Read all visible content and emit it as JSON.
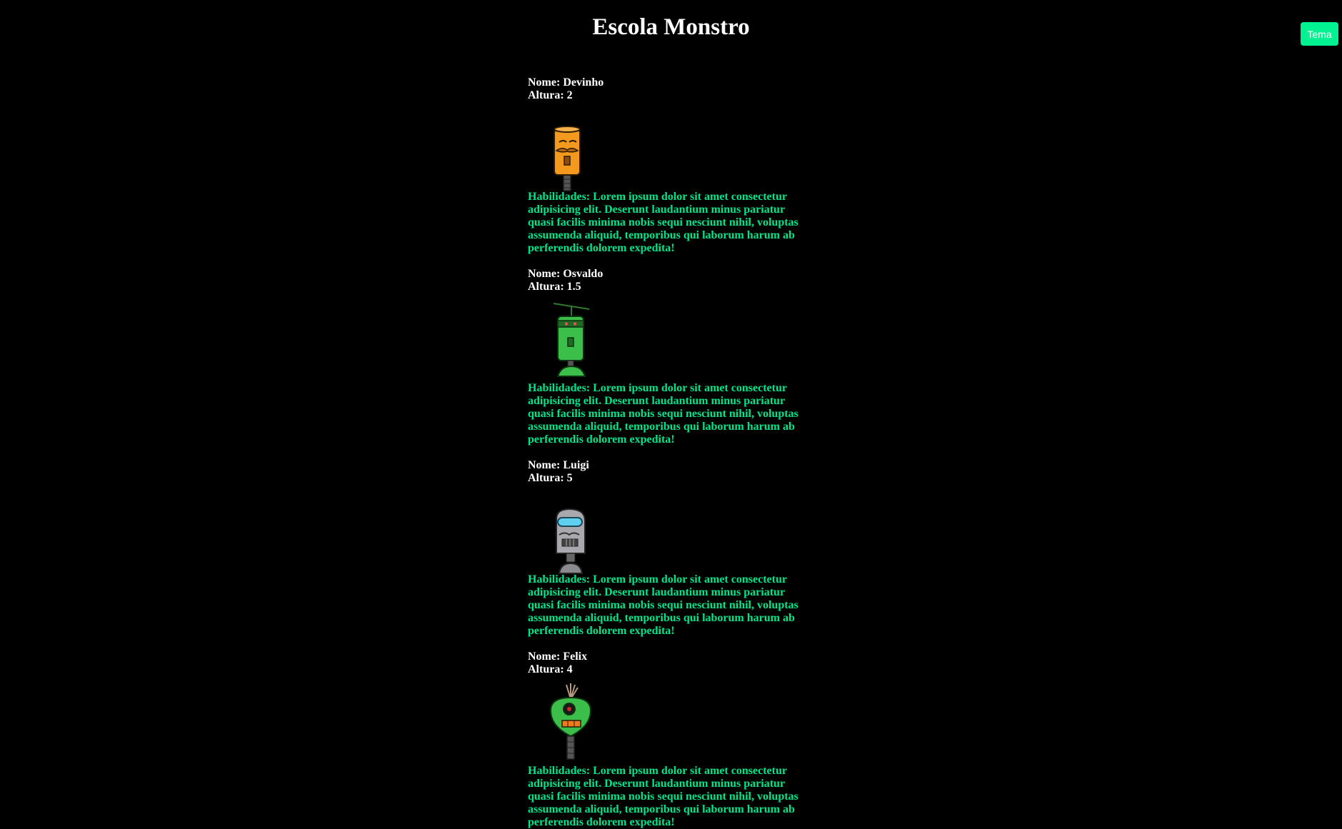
{
  "page": {
    "title": "Escola Monstro",
    "theme_button_label": "Tema"
  },
  "colors": {
    "background": "#000000",
    "text": "#ffffff",
    "accent": "#00e58b",
    "button": "#00f291"
  },
  "labels": {
    "name": "Nome:",
    "height": "Altura:",
    "skills": "Habilidades:"
  },
  "monsters": [
    {
      "name": "Devinho",
      "height": "2",
      "image": "orange-robot",
      "skills_lines": [
        "Habilidades: Lorem ipsum dolor sit amet consectetur",
        "adipisicing elit. Deserunt laudantium minus pariatur",
        "quasi facilis minima nobis sequi nesciunt nihil, voluptas",
        "assumenda aliquid, temporibus qui laborum harum ab",
        "perferendis dolorem expedita!"
      ]
    },
    {
      "name": "Osvaldo",
      "height": "1.5",
      "image": "green-propeller-robot",
      "skills_lines": [
        "Habilidades: Lorem ipsum dolor sit amet consectetur",
        "adipisicing elit. Deserunt laudantium minus pariatur",
        "quasi facilis minima nobis sequi nesciunt nihil, voluptas",
        "assumenda aliquid, temporibus qui laborum harum ab",
        "perferendis dolorem expedita!"
      ]
    },
    {
      "name": "Luigi",
      "height": "5",
      "image": "gray-visor-robot",
      "skills_lines": [
        "Habilidades: Lorem ipsum dolor sit amet consectetur",
        "adipisicing elit. Deserunt laudantium minus pariatur",
        "quasi facilis minima nobis sequi nesciunt nihil, voluptas",
        "assumenda aliquid, temporibus qui laborum harum ab",
        "perferendis dolorem expedita!"
      ]
    },
    {
      "name": "Felix",
      "height": "4",
      "image": "green-cyclops-robot",
      "skills_lines": [
        "Habilidades: Lorem ipsum dolor sit amet consectetur",
        "adipisicing elit. Deserunt laudantium minus pariatur",
        "quasi facilis minima nobis sequi nesciunt nihil, voluptas",
        "assumenda aliquid, temporibus qui laborum harum ab",
        "perferendis dolorem expedita!"
      ]
    }
  ]
}
